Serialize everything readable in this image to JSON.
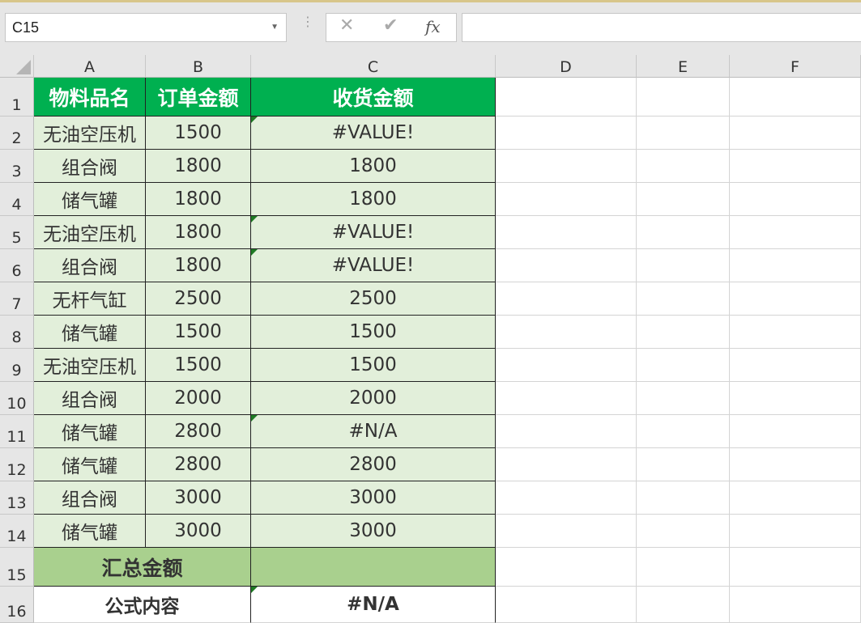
{
  "name_box": "C15",
  "formula_bar": {
    "cancel_icon": "✕",
    "enter_icon": "✔",
    "fx_label": "fx",
    "formula": ""
  },
  "columns": [
    "A",
    "B",
    "C",
    "D",
    "E",
    "F"
  ],
  "rows": [
    "1",
    "2",
    "3",
    "4",
    "5",
    "6",
    "7",
    "8",
    "9",
    "10",
    "11",
    "12",
    "13",
    "14",
    "15",
    "16"
  ],
  "headers": {
    "item": "物料品名",
    "order": "订单金额",
    "received": "收货金额"
  },
  "data": [
    {
      "item": "无油空压机",
      "order": "1500",
      "received": "#VALUE!"
    },
    {
      "item": "组合阀",
      "order": "1800",
      "received": "1800"
    },
    {
      "item": "储气罐",
      "order": "1800",
      "received": "1800"
    },
    {
      "item": "无油空压机",
      "order": "1800",
      "received": "#VALUE!"
    },
    {
      "item": "组合阀",
      "order": "1800",
      "received": "#VALUE!"
    },
    {
      "item": "无杆气缸",
      "order": "2500",
      "received": "2500"
    },
    {
      "item": "储气罐",
      "order": "1500",
      "received": "1500"
    },
    {
      "item": "无油空压机",
      "order": "1500",
      "received": "1500"
    },
    {
      "item": "组合阀",
      "order": "2000",
      "received": "2000"
    },
    {
      "item": "储气罐",
      "order": "2800",
      "received": "#N/A"
    },
    {
      "item": "储气罐",
      "order": "2800",
      "received": "2800"
    },
    {
      "item": "组合阀",
      "order": "3000",
      "received": "3000"
    },
    {
      "item": "储气罐",
      "order": "3000",
      "received": "3000"
    }
  ],
  "total_row": {
    "label": "汇总金额",
    "value": ""
  },
  "formula_row": {
    "label": "公式内容",
    "value": "#N/A"
  },
  "colors": {
    "header_green": "#00b050",
    "data_fill": "#e2efda",
    "total_fill": "#a9d08e",
    "error_marker": "#1f7a24"
  }
}
